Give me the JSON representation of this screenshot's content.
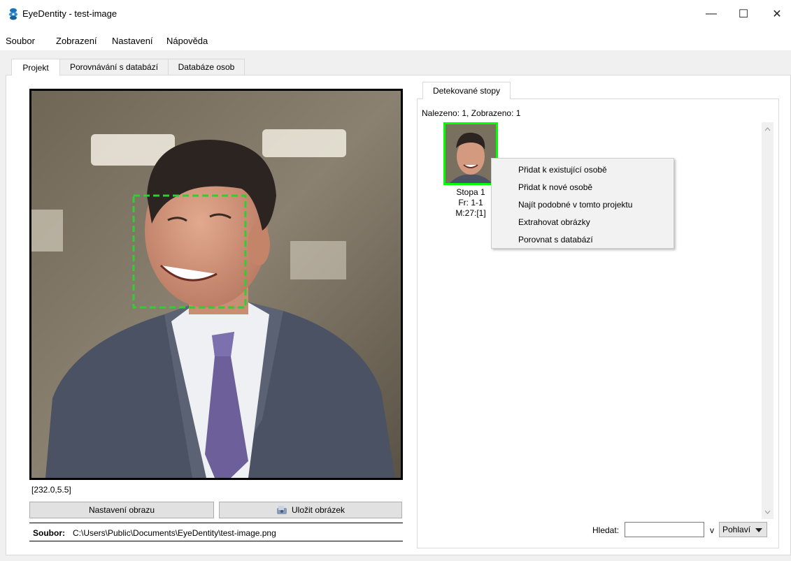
{
  "window": {
    "title": "EyeDentity - test-image",
    "minimize_glyph": "—",
    "maximize_glyph": "☐",
    "close_glyph": "✕"
  },
  "menu": [
    "Soubor",
    "Zobrazení",
    "Nastavení",
    "Nápověda"
  ],
  "tabs": [
    {
      "label": "Projekt",
      "active": true
    },
    {
      "label": "Porovnávání s databází",
      "active": false
    },
    {
      "label": "Databáze osob",
      "active": false
    }
  ],
  "viewer": {
    "cursor_coords": "[232.0,5.5]",
    "image_settings_button": "Nastavení obrazu",
    "save_image_button": "Uložit obrázek",
    "file_label": "Soubor:",
    "file_path": "C:\\Users\\Public\\Documents\\EyeDentity\\test-image.png"
  },
  "tracks": {
    "tab_label": "Detekované stopy",
    "found_summary": "Nalezeno: 1, Zobrazeno: 1",
    "items": [
      {
        "name": "Stopa 1",
        "frames": "Fr: 1-1",
        "meta": "M:27:[1]"
      }
    ]
  },
  "context_menu": [
    "Přidat k existující osobě",
    "Přidat k nové osobě",
    "Najít podobné v tomto projektu",
    "Extrahovat obrázky",
    "Porovnat s databází"
  ],
  "search": {
    "label": "Hledat:",
    "value": "",
    "in_label": "v",
    "field_selected": "Pohlaví"
  },
  "colors": {
    "detection_box": "#33cc33",
    "track_border": "#00ff00",
    "app_icon": "#1a73b8"
  }
}
